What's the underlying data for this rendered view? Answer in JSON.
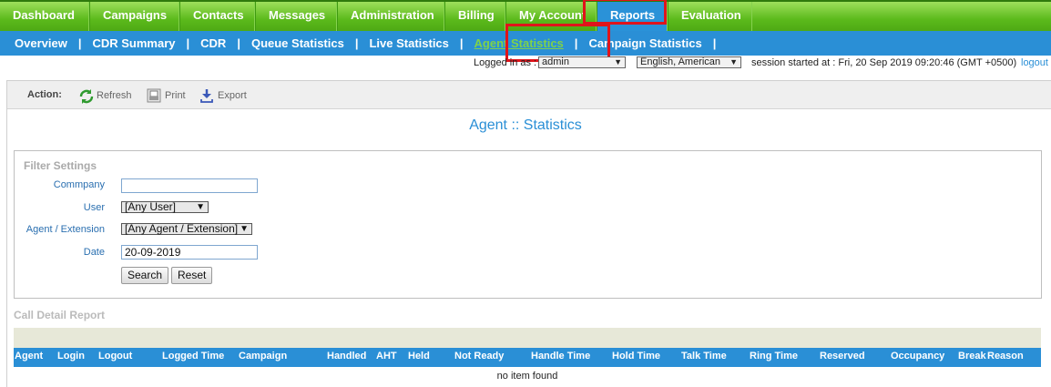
{
  "topnav": [
    "Dashboard",
    "Campaigns",
    "Contacts",
    "Messages",
    "Administration",
    "Billing",
    "My Account",
    "Reports",
    "Evaluation"
  ],
  "subnav": [
    "Overview",
    "CDR Summary",
    "CDR",
    "Queue Statistics",
    "Live Statistics",
    "Agent Statistics",
    "Campaign Statistics"
  ],
  "subnav_sep": "|",
  "status": {
    "logged_in_label": "Logged in as :",
    "user_value": "admin",
    "language_value": "English, American",
    "session_text": "session started at : Fri, 20 Sep 2019 09:20:46 (GMT +0500)",
    "logout": "logout"
  },
  "actions": {
    "label": "Action:",
    "refresh": "Refresh",
    "print": "Print",
    "export": "Export"
  },
  "page_title": "Agent :: Statistics",
  "filter": {
    "legend": "Filter Settings",
    "company_label": "Commpany",
    "company_value": "",
    "user_label": "User",
    "user_value": "[Any User]",
    "agent_label": "Agent / Extension",
    "agent_value": "[Any Agent / Extension]",
    "date_label": "Date",
    "date_value": "20-09-2019",
    "search": "Search",
    "reset": "Reset"
  },
  "report": {
    "title": "Call Detail Report",
    "columns": [
      "Agent",
      "Login",
      "Logout",
      "Logged Time",
      "Campaign",
      "Handled",
      "AHT",
      "Held",
      "Not Ready",
      "Handle Time",
      "Hold Time",
      "Talk Time",
      "Ring Time",
      "Reserved",
      "Occupancy",
      "Break",
      "Reason"
    ],
    "empty_text": "no item found"
  },
  "colors": {
    "nav_green": "#5cba1c",
    "active_blue": "#2a92d8",
    "highlight_red": "#e0141b",
    "active_sub_green": "#7fd24a"
  },
  "icons": [
    "refresh-icon",
    "print-icon",
    "export-icon",
    "chevron-down-icon"
  ]
}
